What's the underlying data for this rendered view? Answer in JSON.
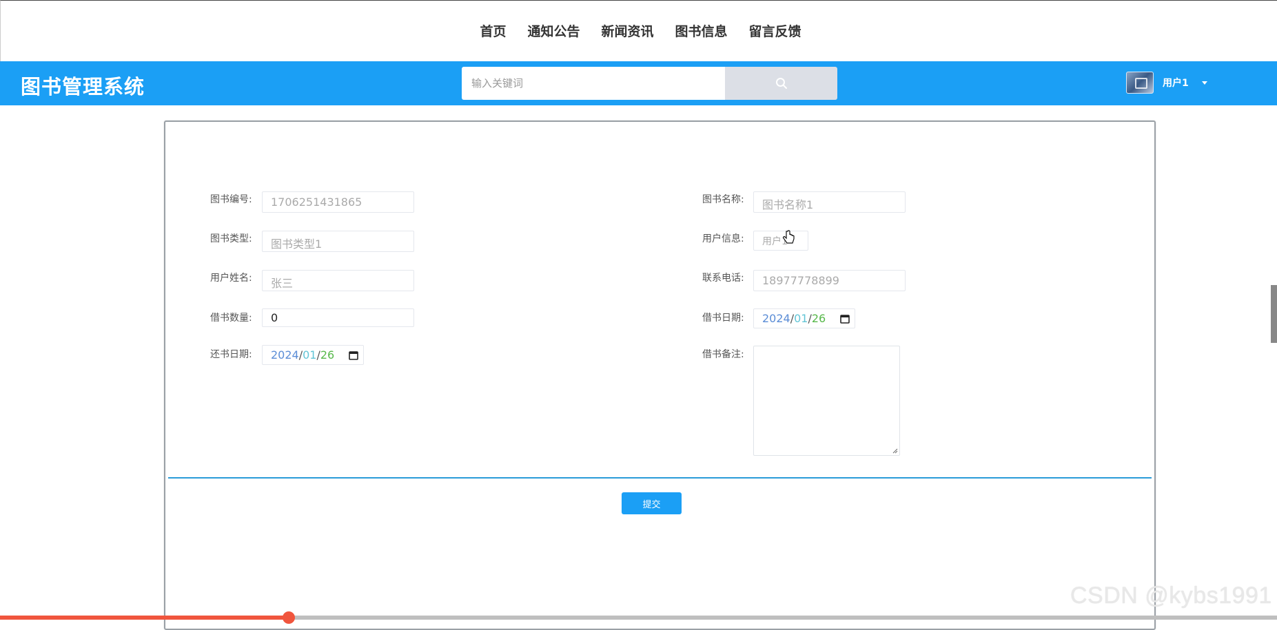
{
  "nav": {
    "items": [
      {
        "label": "首页"
      },
      {
        "label": "通知公告"
      },
      {
        "label": "新闻资讯"
      },
      {
        "label": "图书信息"
      },
      {
        "label": "留言反馈"
      }
    ]
  },
  "header": {
    "brand": "图书管理系统",
    "search": {
      "placeholder": "输入关键词",
      "value": ""
    },
    "user": {
      "name": "用户1"
    }
  },
  "form": {
    "book_no": {
      "label": "图书编号:",
      "value": "1706251431865"
    },
    "book_name": {
      "label": "图书名称:",
      "value": "图书名称1"
    },
    "book_type": {
      "label": "图书类型:",
      "value": "图书类型1"
    },
    "user_info": {
      "label": "用户信息:",
      "value": "用户1"
    },
    "user_name": {
      "label": "用户姓名:",
      "value": "张三"
    },
    "phone": {
      "label": "联系电话:",
      "value": "18977778899"
    },
    "borrow_count": {
      "label": "借书数量:",
      "value": "0"
    },
    "borrow_date": {
      "label": "借书日期:",
      "year": "2024",
      "month": "01",
      "day": "26"
    },
    "return_date": {
      "label": "还书日期:",
      "year": "2024",
      "month": "01",
      "day": "26"
    },
    "remark": {
      "label": "借书备注:",
      "value": ""
    },
    "submit_label": "提交"
  },
  "video": {
    "progress": 0.226
  },
  "watermark": "CSDN @kybs1991"
}
